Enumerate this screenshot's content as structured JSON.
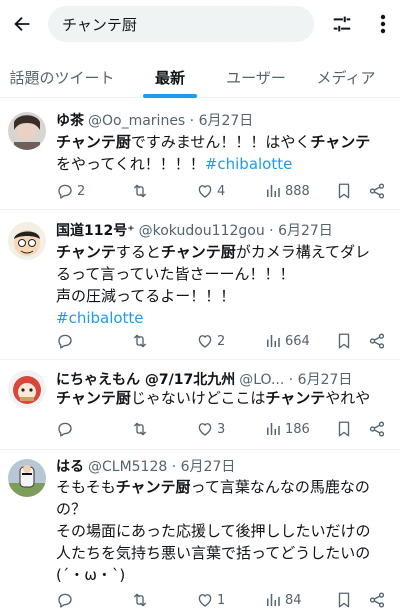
{
  "search": {
    "query": "チャンテ厨"
  },
  "tabs": [
    {
      "label": "話題のツイート"
    },
    {
      "label": "最新"
    },
    {
      "label": "ユーザー"
    },
    {
      "label": "メディア"
    }
  ],
  "tweets": [
    {
      "name": "ゆ茶",
      "handle": "@Oo_marines · 6月27日",
      "lines": [
        [
          {
            "b": "チャンテ厨"
          },
          {
            "t": "ですみません！！！はやく"
          },
          {
            "b": "チャンテ"
          }
        ],
        [
          {
            "t": "をやってくれ！！！！"
          },
          {
            "h": "#chibalotte"
          }
        ]
      ],
      "replies": "2",
      "retweets": "",
      "likes": "4",
      "views": "888"
    },
    {
      "name": "国道112号⁺",
      "handle": "@kokudou112gou · 6月27日",
      "lines": [
        [
          {
            "b": "チャンテ"
          },
          {
            "t": "すると"
          },
          {
            "b": "チャンテ厨"
          },
          {
            "t": "がカメラ構えてダレ"
          }
        ],
        [
          {
            "t": "るって言っていた皆さーーん！！！"
          }
        ],
        [
          {
            "t": "声の圧減ってるよー！！！"
          }
        ],
        [
          {
            "h": "#chibalotte"
          }
        ]
      ],
      "replies": "",
      "retweets": "",
      "likes": "2",
      "views": "664"
    },
    {
      "name": "にちゃえもん @7/17北九州",
      "handle": "@LO... · 6月27日",
      "lines": [
        [
          {
            "b": "チャンテ厨"
          },
          {
            "t": "じゃないけどここは"
          },
          {
            "b": "チャンテ"
          },
          {
            "t": "やれや"
          }
        ]
      ],
      "replies": "",
      "retweets": "",
      "likes": "3",
      "views": "186"
    },
    {
      "name": "はる",
      "handle": "@CLM5128 · 6月27日",
      "lines": [
        [
          {
            "t": "そもそも"
          },
          {
            "b": "チャンテ厨"
          },
          {
            "t": "って言葉なんなの馬鹿なの"
          }
        ],
        [
          {
            "t": "の？"
          }
        ],
        [
          {
            "t": "その場面にあった応援して後押ししたいだけの"
          }
        ],
        [
          {
            "t": "人たちを気持ち悪い言葉で括ってどうしたいの"
          }
        ],
        [
          {
            "t": "(´・ω・`)"
          }
        ]
      ],
      "replies": "",
      "retweets": "",
      "likes": "1",
      "views": "84"
    }
  ],
  "icons": {
    "back": "arrow-left-icon",
    "filter": "sliders-icon",
    "more": "more-vertical-icon",
    "reply": "reply-icon",
    "retweet": "retweet-icon",
    "like": "heart-icon",
    "views": "views-chart-icon",
    "bookmark": "bookmark-icon",
    "share": "share-icon"
  },
  "colors": {
    "accent": "#1d9bf0",
    "text": "#0f1419",
    "muted": "#536471",
    "divider": "#eff3f4",
    "searchBg": "#eff3f4"
  }
}
